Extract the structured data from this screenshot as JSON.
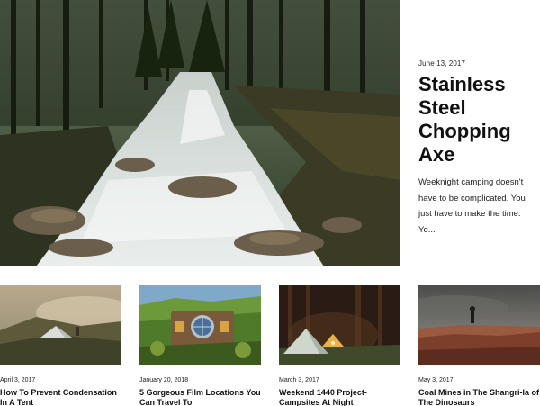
{
  "hero": {
    "date": "June 13, 2017",
    "title": "Stainless Steel Chopping Axe",
    "excerpt": "Weeknight camping doesn't have to be complicated. You just have to make the time. Yo..."
  },
  "posts": [
    {
      "date": "April 3, 2017",
      "title": "How To Prevent Condensation In A Tent"
    },
    {
      "date": "January 20, 2018",
      "title": "5 Gorgeous Film Locations You Can Travel To"
    },
    {
      "date": "March 3, 2017",
      "title": "Weekend 1440 Project- Campsites At Night"
    },
    {
      "date": "May 3, 2017",
      "title": "Coal Mines in The Shangri-la of The Dinosaurs"
    }
  ]
}
